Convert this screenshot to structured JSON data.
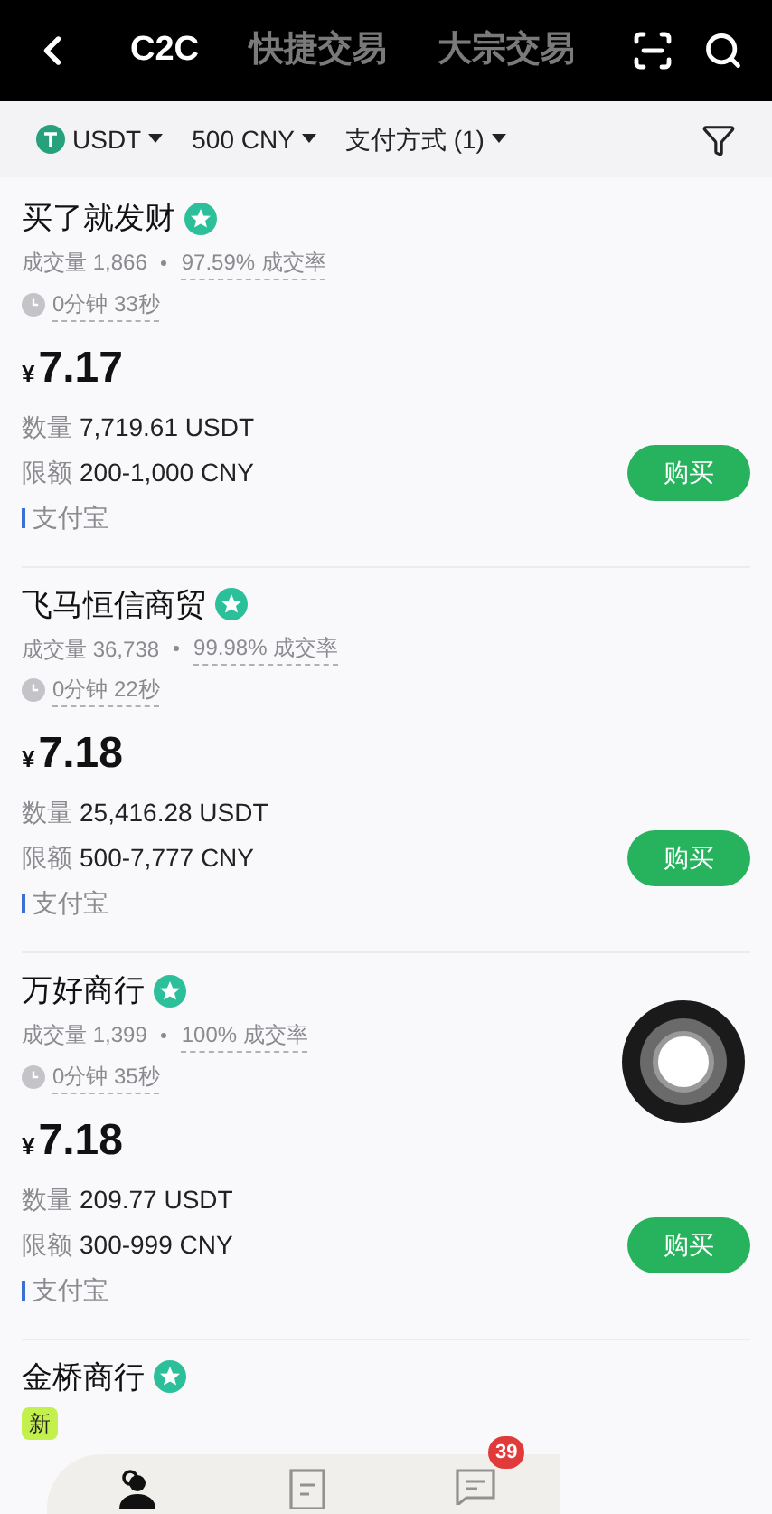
{
  "header": {
    "tabs": [
      {
        "label": "C2C",
        "selected": true
      },
      {
        "label": "快捷交易",
        "selected": false
      },
      {
        "label": "大宗交易",
        "selected": false
      }
    ]
  },
  "filters": [
    {
      "kind": "coin",
      "label": "USDT"
    },
    {
      "kind": "plain",
      "label": "500 CNY"
    },
    {
      "kind": "plain",
      "label": "支付方式 (1)"
    }
  ],
  "merchants": [
    {
      "name": "买了就发财",
      "verified": true,
      "volume": "成交量 1,866",
      "rate": "97.59% 成交率",
      "time": "0分钟 33秒",
      "currency": "¥",
      "price": "7.17",
      "quantity_label": "数量",
      "quantity": "7,719.61 USDT",
      "limit_label": "限额",
      "limit": "200-1,000 CNY",
      "payment": "支付宝",
      "button": "购买"
    },
    {
      "name": "飞马恒信商贸",
      "verified": true,
      "volume": "成交量 36,738",
      "rate": "99.98% 成交率",
      "time": "0分钟 22秒",
      "currency": "¥",
      "price": "7.18",
      "quantity_label": "数量",
      "quantity": "25,416.28 USDT",
      "limit_label": "限额",
      "limit": "500-7,777 CNY",
      "payment": "支付宝",
      "button": "购买"
    },
    {
      "name": "万好商行",
      "verified": true,
      "volume": "成交量 1,399",
      "rate": "100% 成交率",
      "time": "0分钟 35秒",
      "currency": "¥",
      "price": "7.18",
      "quantity_label": "数量",
      "quantity": "209.77 USDT",
      "limit_label": "限额",
      "limit": "300-999 CNY",
      "payment": "支付宝",
      "button": "购买"
    },
    {
      "name": "金桥商行",
      "verified": true,
      "tag": "新"
    }
  ],
  "bottom_nav": [
    {
      "kind": "people",
      "selected": true
    },
    {
      "kind": "orders",
      "selected": false
    },
    {
      "kind": "messages",
      "selected": false,
      "badge": "39"
    }
  ]
}
